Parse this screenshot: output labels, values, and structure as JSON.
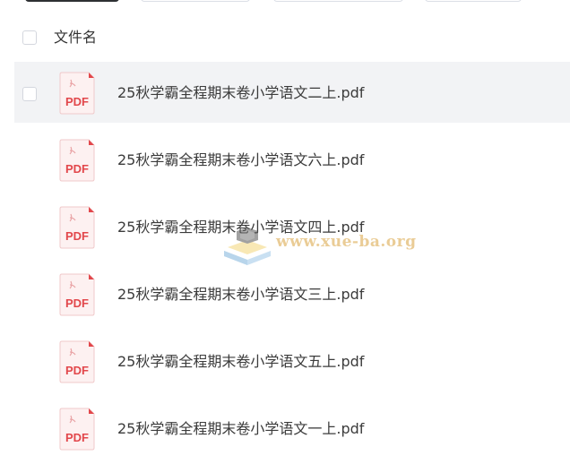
{
  "list": {
    "header_label": "文件名",
    "files": [
      {
        "name": "25秋学霸全程期末卷小学语文二上.pdf",
        "icon": "pdf-file-icon",
        "icon_label": "PDF"
      },
      {
        "name": "25秋学霸全程期末卷小学语文六上.pdf",
        "icon": "pdf-file-icon",
        "icon_label": "PDF"
      },
      {
        "name": "25秋学霸全程期末卷小学语文四上.pdf",
        "icon": "pdf-file-icon",
        "icon_label": "PDF"
      },
      {
        "name": "25秋学霸全程期末卷小学语文三上.pdf",
        "icon": "pdf-file-icon",
        "icon_label": "PDF"
      },
      {
        "name": "25秋学霸全程期末卷小学语文五上.pdf",
        "icon": "pdf-file-icon",
        "icon_label": "PDF"
      },
      {
        "name": "25秋学霸全程期末卷小学语文一上.pdf",
        "icon": "pdf-file-icon",
        "icon_label": "PDF"
      }
    ]
  },
  "watermark": {
    "text": "www.xue-ba.org"
  },
  "colors": {
    "pdf_red": "#e2474b",
    "row_hover": "#f2f3f5",
    "checkbox_border": "#d4d7de",
    "watermark": "#d9a441"
  }
}
